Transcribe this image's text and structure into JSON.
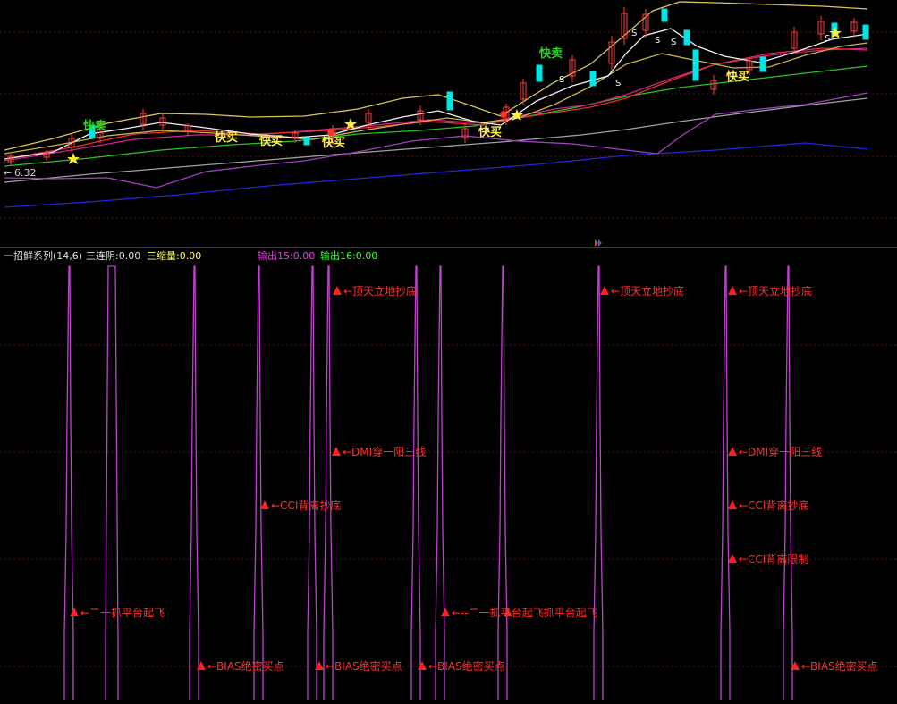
{
  "price_label": "6.32",
  "indicator_header": {
    "name": "一招鲜系列(14,6)",
    "item1": "三连阴:0.00",
    "item2": "三缩量:0.00",
    "item3": "输出15:0.00",
    "item4": "输出16:0.00"
  },
  "signals": {
    "fast_sell": "快卖",
    "fast_buy": "快买",
    "s_mark": "S"
  },
  "annotations": [
    {
      "text": "←顶天立地抄底"
    },
    {
      "text": "←顶天立地抄底"
    },
    {
      "text": "←顶天立地抄底"
    },
    {
      "text": "←DMI穿一阳三线"
    },
    {
      "text": "←DMI穿一阳三线"
    },
    {
      "text": "←CCI背离抄底"
    },
    {
      "text": "←CCI背离抄底"
    },
    {
      "text": "←CCI背离限制"
    },
    {
      "text": "←二一抓平台起飞"
    },
    {
      "text": "←--二一抓平台起飞抓平台起飞"
    },
    {
      "text": "←BIAS绝密买点"
    },
    {
      "text": "←BIAS绝密买点"
    },
    {
      "text": "←BIAS绝密买点"
    },
    {
      "text": "←BIAS绝密买点"
    }
  ],
  "colors": {
    "background": "#000000",
    "grid": "#5a0f0f",
    "up_candle": "#ff3b3b",
    "down_candle": "#00e5e5",
    "ma_white": "#f2f2f2",
    "ma_yellow": "#d8c55a",
    "ma_magenta": "#d02090",
    "ma_red": "#e83030",
    "ma_green": "#27c427",
    "ma_gray": "#a0a0a0",
    "ma_purple": "#a040c0",
    "ma_blue": "#2626d8",
    "spike": "#c040d0",
    "annotation": "#ff3030",
    "header_white": "#e0e0e0",
    "header_yellow": "#ffff66",
    "header_magenta": "#e040e0",
    "header_green": "#40ff40",
    "signal_green": "#20dd20",
    "signal_yellow": "#ffee55",
    "star": "#ffee33"
  }
}
